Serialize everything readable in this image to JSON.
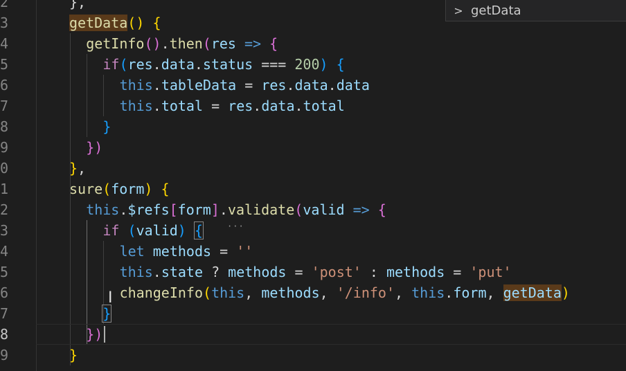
{
  "sticky_breadcrumb": {
    "chevron": ">",
    "label": "getData"
  },
  "line_numbers": [
    "2",
    "3",
    "4",
    "5",
    "6",
    "7",
    "8",
    "9",
    "0",
    "1",
    "2",
    "3",
    "4",
    "5",
    "6",
    "7",
    "8",
    "9"
  ],
  "code_lines": [
    [
      [
        "p",
        "},"
      ]
    ],
    [
      [
        "fn",
        "getData",
        1
      ],
      [
        "b1",
        "("
      ],
      [
        "b1",
        ")"
      ],
      [
        "p",
        " "
      ],
      [
        "b1",
        "{"
      ]
    ],
    [
      [
        "fn",
        "getInfo"
      ],
      [
        "b2",
        "("
      ],
      [
        "b2",
        ")"
      ],
      [
        "p",
        "."
      ],
      [
        "fn",
        "then"
      ],
      [
        "b2",
        "("
      ],
      [
        "var",
        "res"
      ],
      [
        "p",
        " "
      ],
      [
        "kw",
        "=>"
      ],
      [
        "p",
        " "
      ],
      [
        "b2",
        "{"
      ]
    ],
    [
      [
        "ctrl",
        "if"
      ],
      [
        "b3",
        "("
      ],
      [
        "var",
        "res"
      ],
      [
        "p",
        "."
      ],
      [
        "var",
        "data"
      ],
      [
        "p",
        "."
      ],
      [
        "var",
        "status"
      ],
      [
        "p",
        " === "
      ],
      [
        "num",
        "200"
      ],
      [
        "b3",
        ")"
      ],
      [
        "p",
        " "
      ],
      [
        "b3",
        "{"
      ]
    ],
    [
      [
        "kw",
        "this"
      ],
      [
        "p",
        "."
      ],
      [
        "var",
        "tableData"
      ],
      [
        "p",
        " = "
      ],
      [
        "var",
        "res"
      ],
      [
        "p",
        "."
      ],
      [
        "var",
        "data"
      ],
      [
        "p",
        "."
      ],
      [
        "var",
        "data"
      ]
    ],
    [
      [
        "kw",
        "this"
      ],
      [
        "p",
        "."
      ],
      [
        "var",
        "total"
      ],
      [
        "p",
        " = "
      ],
      [
        "var",
        "res"
      ],
      [
        "p",
        "."
      ],
      [
        "var",
        "data"
      ],
      [
        "p",
        "."
      ],
      [
        "var",
        "total"
      ]
    ],
    [
      [
        "b3",
        "}"
      ]
    ],
    [
      [
        "b2",
        "}"
      ],
      [
        "b2",
        ")"
      ]
    ],
    [
      [
        "b1",
        "}"
      ],
      [
        "p",
        ","
      ]
    ],
    [
      [
        "fn",
        "sure"
      ],
      [
        "b1",
        "("
      ],
      [
        "var",
        "form"
      ],
      [
        "b1",
        ")"
      ],
      [
        "p",
        " "
      ],
      [
        "b1",
        "{"
      ]
    ],
    [
      [
        "kw",
        "this"
      ],
      [
        "p",
        "."
      ],
      [
        "var",
        "$refs"
      ],
      [
        "b2",
        "["
      ],
      [
        "var",
        "form"
      ],
      [
        "b2",
        "]"
      ],
      [
        "p",
        "."
      ],
      [
        "fn",
        "validate"
      ],
      [
        "b2",
        "("
      ],
      [
        "var",
        "valid"
      ],
      [
        "p",
        " "
      ],
      [
        "kw",
        "=>"
      ],
      [
        "p",
        " "
      ],
      [
        "b2",
        "{"
      ]
    ],
    [
      [
        "ctrl",
        "if"
      ],
      [
        "p",
        " "
      ],
      [
        "b3",
        "("
      ],
      [
        "var",
        "valid"
      ],
      [
        "b3",
        ")"
      ],
      [
        "p",
        " "
      ],
      [
        "b3",
        "{",
        2
      ]
    ],
    [
      [
        "kw",
        "let"
      ],
      [
        "p",
        " "
      ],
      [
        "var",
        "methods"
      ],
      [
        "p",
        " = "
      ],
      [
        "str",
        "''"
      ]
    ],
    [
      [
        "kw",
        "this"
      ],
      [
        "p",
        "."
      ],
      [
        "var",
        "state"
      ],
      [
        "p",
        " ? "
      ],
      [
        "var",
        "methods"
      ],
      [
        "p",
        " = "
      ],
      [
        "str",
        "'post'"
      ],
      [
        "p",
        " : "
      ],
      [
        "var",
        "methods"
      ],
      [
        "p",
        " = "
      ],
      [
        "str",
        "'put'"
      ]
    ],
    [
      [
        "fn",
        "changeInfo"
      ],
      [
        "b1",
        "("
      ],
      [
        "kw",
        "this"
      ],
      [
        "p",
        ", "
      ],
      [
        "var",
        "methods"
      ],
      [
        "p",
        ", "
      ],
      [
        "str",
        "'/info'"
      ],
      [
        "p",
        ", "
      ],
      [
        "kw",
        "this"
      ],
      [
        "p",
        "."
      ],
      [
        "var",
        "form"
      ],
      [
        "p",
        ", "
      ],
      [
        "var",
        "getData",
        1
      ],
      [
        "b1",
        ")"
      ]
    ],
    [
      [
        "b3",
        "}",
        2
      ]
    ],
    [
      [
        "b2",
        "}"
      ],
      [
        "b2",
        ")"
      ]
    ],
    [
      [
        "b1",
        "}"
      ]
    ]
  ],
  "icons": {
    "breadcrumb": "chevron-right-icon",
    "mouse": "text-cursor-icon"
  },
  "colors": {
    "background": "#1e1e1e",
    "keyword": "#569cd6",
    "function": "#dcdcaa",
    "variable": "#9cdcfe",
    "string": "#ce9178",
    "number": "#b5cea8",
    "control": "#c586c0",
    "bracket_level_1": "#ffd700",
    "bracket_level_2": "#da70d6",
    "bracket_level_3": "#179fff",
    "highlight": "#5a3a1a"
  }
}
